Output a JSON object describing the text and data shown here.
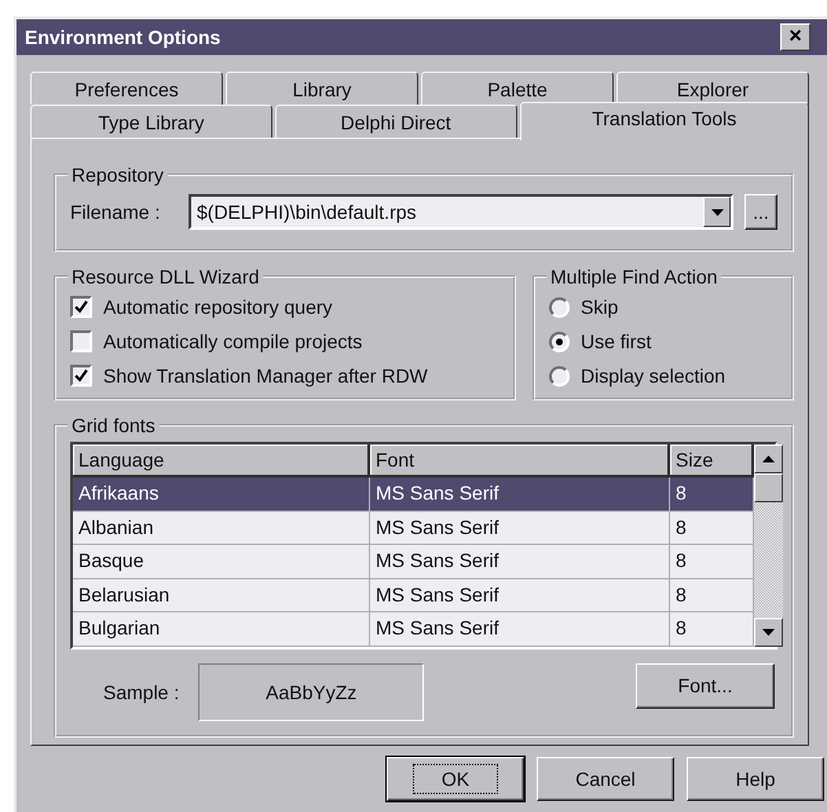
{
  "window": {
    "title": "Environment Options",
    "close_button": "×"
  },
  "tab_rows": [
    [
      {
        "label": "Preferences",
        "selected": false
      },
      {
        "label": "Library",
        "selected": false
      },
      {
        "label": "Palette",
        "selected": false
      },
      {
        "label": "Explorer",
        "selected": false
      }
    ],
    [
      {
        "label": "Type Library",
        "selected": false
      },
      {
        "label": "Delphi Direct",
        "selected": false
      },
      {
        "label": "Translation Tools",
        "selected": true
      }
    ]
  ],
  "repository": {
    "title": "Repository",
    "filename_label": "Filename :",
    "filename_value": "$(DELPHI)\\bin\\default.rps",
    "browse_button": "..."
  },
  "resource_dll_wizard": {
    "title": "Resource DLL Wizard",
    "options": [
      {
        "label": "Automatic repository query",
        "checked": true
      },
      {
        "label": "Automatically compile projects",
        "checked": false
      },
      {
        "label": "Show Translation Manager after RDW",
        "checked": true
      }
    ]
  },
  "multiple_find_action": {
    "title": "Multiple Find Action",
    "options": [
      {
        "label": "Skip",
        "selected": false
      },
      {
        "label": "Use first",
        "selected": true
      },
      {
        "label": "Display selection",
        "selected": false
      }
    ]
  },
  "grid_fonts": {
    "title": "Grid fonts",
    "table": {
      "columns": [
        "Language",
        "Font",
        "Size"
      ],
      "rows": [
        {
          "cells": [
            "Afrikaans",
            "MS Sans Serif",
            "8"
          ],
          "selected": true
        },
        {
          "cells": [
            "Albanian",
            "MS Sans Serif",
            "8"
          ],
          "selected": false
        },
        {
          "cells": [
            "Basque",
            "MS Sans Serif",
            "8"
          ],
          "selected": false
        },
        {
          "cells": [
            "Belarusian",
            "MS Sans Serif",
            "8"
          ],
          "selected": false
        },
        {
          "cells": [
            "Bulgarian",
            "MS Sans Serif",
            "8"
          ],
          "selected": false
        }
      ]
    },
    "sample_label": "Sample :",
    "sample_text": "AaBbYyZz",
    "font_button": "Font..."
  },
  "buttons": [
    {
      "label": "OK",
      "default": true
    },
    {
      "label": "Cancel",
      "default": false
    },
    {
      "label": "Help",
      "default": false
    }
  ]
}
